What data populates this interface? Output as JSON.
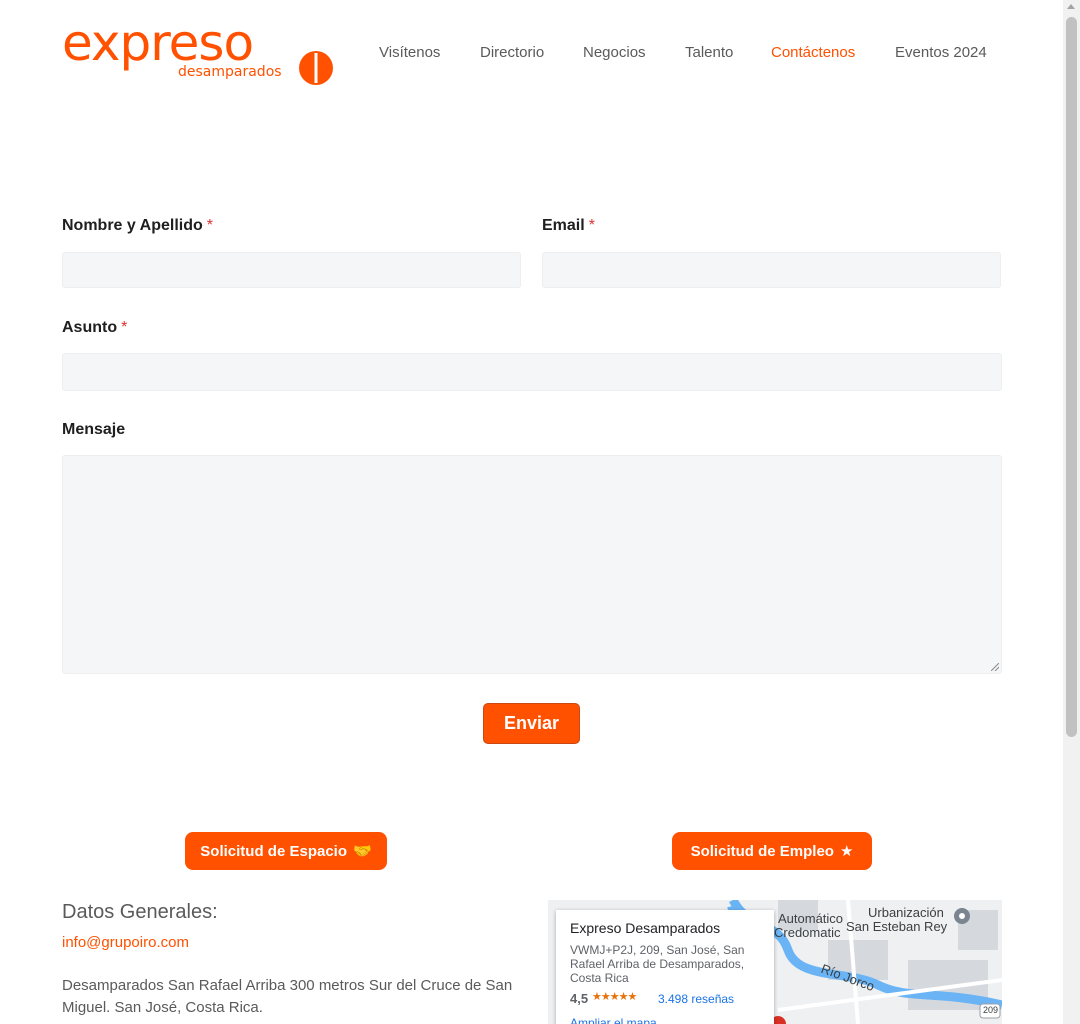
{
  "header": {
    "logo_text": "expreso",
    "logo_subtext": "desamparados",
    "nav": [
      {
        "label": "Visítenos",
        "active": false
      },
      {
        "label": "Directorio",
        "active": false
      },
      {
        "label": "Negocios",
        "active": false
      },
      {
        "label": "Talento",
        "active": false
      },
      {
        "label": "Contáctenos",
        "active": true
      },
      {
        "label": "Eventos 2024",
        "active": false
      }
    ]
  },
  "form": {
    "name_label": "Nombre y Apellido",
    "email_label": "Email",
    "subject_label": "Asunto",
    "message_label": "Mensaje",
    "required_mark": "*",
    "name_value": "",
    "email_value": "",
    "subject_value": "",
    "message_value": "",
    "submit_label": "Enviar"
  },
  "actions": {
    "space_request_label": "Solicitud de Espacio",
    "job_request_label": "Solicitud de Empleo"
  },
  "info": {
    "title": "Datos Generales:",
    "email": "info@grupoiro.com",
    "address": "Desamparados San Rafael Arriba 300 metros Sur del Cruce de San Miguel. San José, Costa Rica."
  },
  "map": {
    "place_name": "Expreso Desamparados",
    "place_address": "VWMJ+P2J, 209, San José, San Rafael Arriba de Desamparados, Costa Rica",
    "rating": "4,5",
    "stars": "★★★★★",
    "reviews": "3.498 reseñas",
    "enlarge_link": "Ampliar el mapa",
    "labels": {
      "automatico": "Automático",
      "credomatic": "Credomatic",
      "urbanizacion": "Urbanización",
      "san_esteban": "San Esteban Rey",
      "rio_jorco": "Río Jorco",
      "route": "209"
    }
  },
  "colors": {
    "accent": "#ff5100",
    "field_bg": "#f5f6f7",
    "text": "#1f1f1f",
    "muted": "#5a5a5a"
  }
}
